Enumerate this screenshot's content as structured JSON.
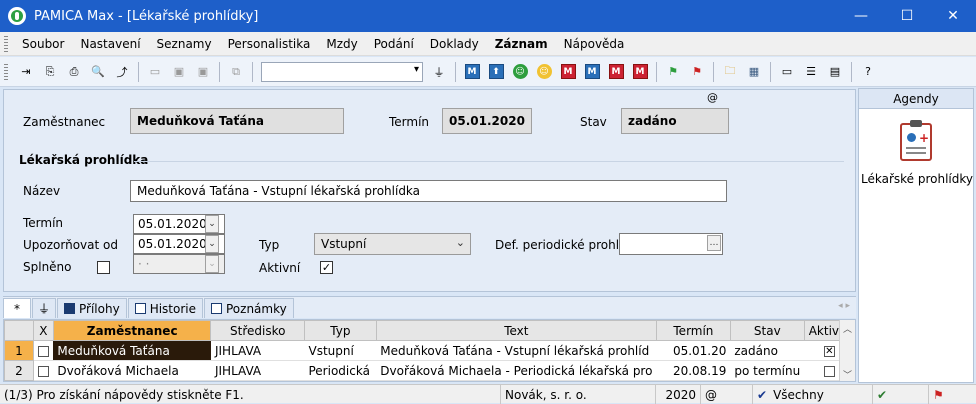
{
  "window": {
    "title": "PAMICA Max - [Lékařské prohlídky]",
    "minimize_glyph": "—",
    "maximize_glyph": "☐",
    "close_glyph": "✕"
  },
  "menu": {
    "items": [
      "Soubor",
      "Nastavení",
      "Seznamy",
      "Personalistika",
      "Mzdy",
      "Podání",
      "Doklady",
      "Záznam",
      "Nápověda"
    ],
    "bold_item": "Záznam"
  },
  "toolbar": {
    "search_value": "",
    "m_label": "M",
    "icons": [
      "new-record-icon",
      "copy-record-icon",
      "print-icon",
      "preview-icon",
      "export-icon",
      "doc-icon",
      "save-icon",
      "cancel-icon",
      "paste-icon",
      "filter-icon",
      "m-icon",
      "person-icon",
      "green-person-icon",
      "yellow-person-icon",
      "m-red-icon",
      "flag-green-icon",
      "flag-red-icon",
      "folder-icon",
      "calculator-icon",
      "list-icon",
      "help-icon"
    ]
  },
  "form": {
    "at_symbol": "@",
    "employee_label": "Zaměstnanec",
    "employee_value": "Meduňková Taťána",
    "term_label": "Termín",
    "term_value": "05.01.2020",
    "state_label": "Stav",
    "state_value": "zadáno",
    "section_title": "Lékařská prohlídka",
    "name_label": "Název",
    "name_value": "Meduňková Taťána - Vstupní lékařská prohlídka",
    "term2_label": "Termín",
    "term2_value": "05.01.2020",
    "notify_label": "Upozorňovat od",
    "notify_value": "05.01.2020",
    "done_label": "Splněno",
    "done_value": "· ·",
    "type_label": "Typ",
    "type_value": "Vstupní",
    "active_label": "Aktivní",
    "active_checked": true,
    "check_glyph": "✓",
    "def_label": "Def. periodické prohl.",
    "def_value": ""
  },
  "agenda": {
    "title": "Agendy",
    "item_label": "Lékařské prohlídky"
  },
  "tabs": [
    {
      "label": "*"
    },
    {
      "label": ""
    },
    {
      "label": "Přílohy"
    },
    {
      "label": "Historie"
    },
    {
      "label": "Poznámky"
    }
  ],
  "grid": {
    "columns": [
      "",
      "X",
      "Zaměstnanec",
      "Středisko",
      "Typ",
      "Text",
      "Termín",
      "Stav",
      "Aktivní"
    ],
    "rows": [
      {
        "num": "1",
        "name": "Meduňková Taťána",
        "center": "JIHLAVA",
        "type": "Vstupní",
        "text": "Meduňková Taťána - Vstupní lékařská prohlíd",
        "term": "05.01.20",
        "state": "zadáno",
        "active": "✕"
      },
      {
        "num": "2",
        "name": "Dvořáková Michaela",
        "center": "JIHLAVA",
        "type": "Periodická",
        "text": "Dvořáková Michaela - Periodická lékařská pro",
        "term": "20.08.19",
        "state": "po termínu",
        "active": ""
      }
    ]
  },
  "status": {
    "help_text": "(1/3) Pro získání nápovědy stiskněte F1.",
    "company": "Novák, s. r. o.",
    "year": "2020",
    "at": "@",
    "filter": "Všechny"
  }
}
